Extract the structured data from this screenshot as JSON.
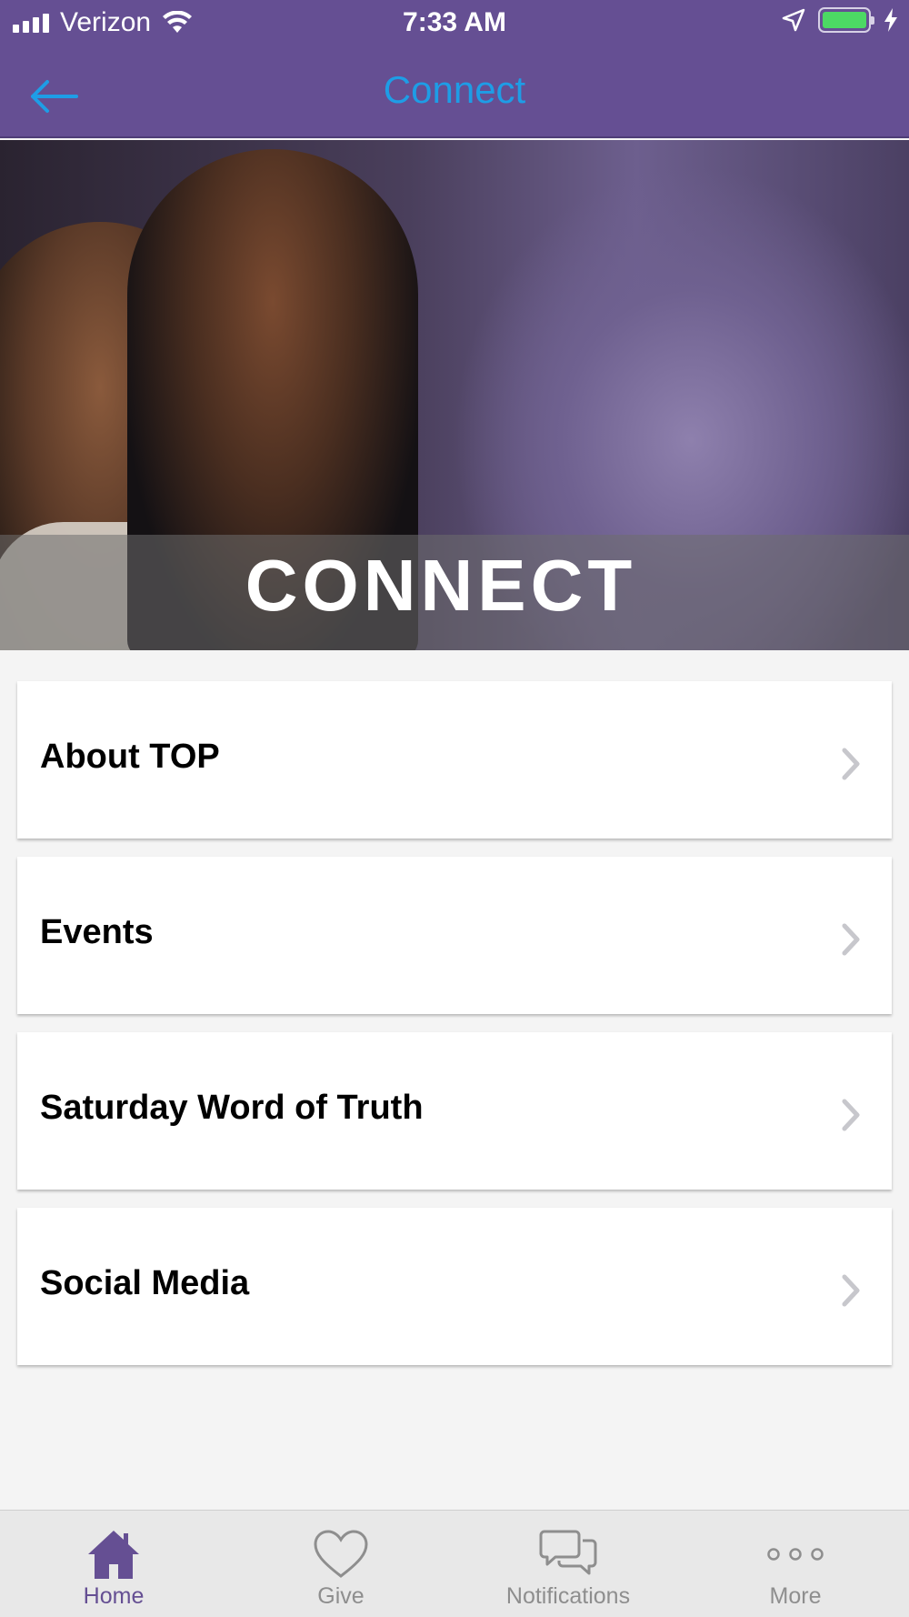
{
  "status_bar": {
    "carrier": "Verizon",
    "time": "7:33 AM",
    "battery_level": 1.0
  },
  "nav": {
    "title": "Connect",
    "back_icon": "arrow-left-icon"
  },
  "hero": {
    "title": "CONNECT"
  },
  "menu": {
    "items": [
      {
        "label": "About TOP"
      },
      {
        "label": "Events"
      },
      {
        "label": "Saturday Word of Truth"
      },
      {
        "label": "Social Media"
      }
    ]
  },
  "tab_bar": {
    "tabs": [
      {
        "label": "Home",
        "icon": "home-icon",
        "active": true
      },
      {
        "label": "Give",
        "icon": "heart-icon",
        "active": false
      },
      {
        "label": "Notifications",
        "icon": "chat-bubbles-icon",
        "active": false
      },
      {
        "label": "More",
        "icon": "more-dots-icon",
        "active": false
      }
    ]
  },
  "colors": {
    "header_background": "#654f93",
    "accent_blue": "#1e9de6",
    "active_tab": "#654f93",
    "inactive_tab": "#8e8e8e",
    "battery_green": "#4cd964"
  }
}
